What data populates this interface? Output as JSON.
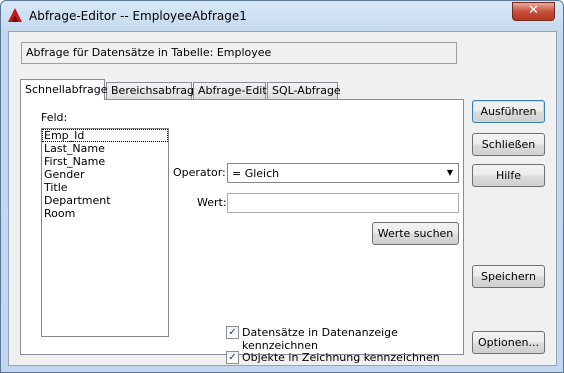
{
  "window": {
    "title": "Abfrage-Editor -- EmployeeAbfrage1",
    "close_glyph": "✕",
    "app_icon": "autocad-red-a-icon"
  },
  "info": {
    "text": "Abfrage für Datensätze in Tabelle:  Employee"
  },
  "tabs": [
    {
      "label": "Schnellabfrage",
      "active": true
    },
    {
      "label": "Bereichsabfrage",
      "active": false
    },
    {
      "label": "Abfrage-Editor",
      "active": false
    },
    {
      "label": "SQL-Abfrage",
      "active": false
    }
  ],
  "field": {
    "label": "Feld:",
    "items": [
      "Emp_Id",
      "Last_Name",
      "First_Name",
      "Gender",
      "Title",
      "Department",
      "Room"
    ],
    "selected": "Emp_Id"
  },
  "operator": {
    "label": "Operator:",
    "value": "=   Gleich"
  },
  "value": {
    "label": "Wert:",
    "text": ""
  },
  "buttons": {
    "find_values": "Werte suchen",
    "execute": "Ausführen",
    "close": "Schließen",
    "help": "Hilfe",
    "save": "Speichern",
    "options": "Optionen..."
  },
  "checkboxes": [
    {
      "label": "Datensätze in Datenanzeige kennzeichnen",
      "checked": true
    },
    {
      "label": "Objekte in Zeichnung kennzeichnen",
      "checked": true
    }
  ],
  "check_glyph": "✓",
  "dropdown_glyph": "▼"
}
